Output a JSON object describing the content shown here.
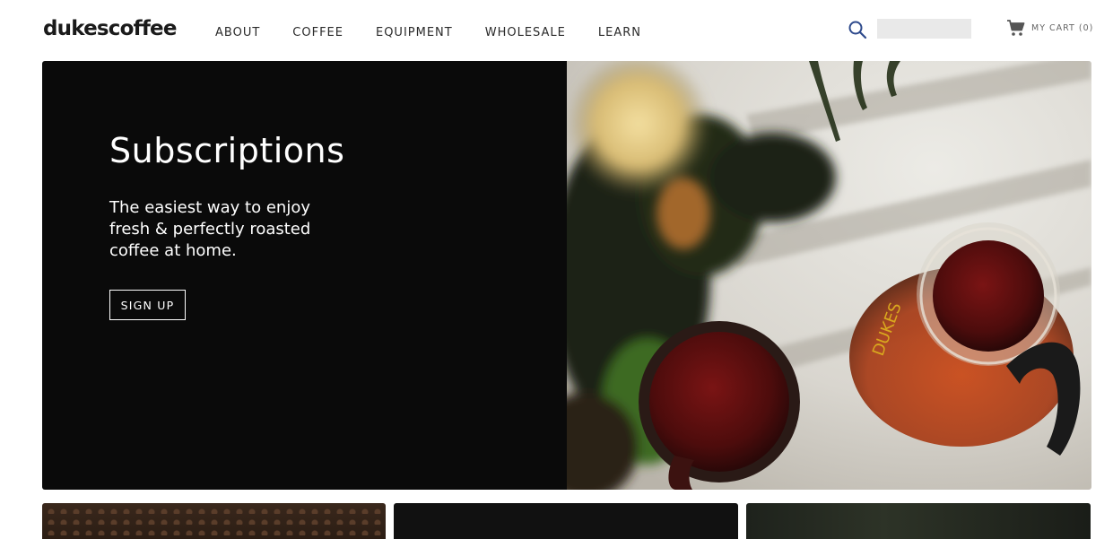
{
  "header": {
    "logo": "dukescoffee",
    "nav": [
      {
        "label": "ABOUT"
      },
      {
        "label": "COFFEE"
      },
      {
        "label": "EQUIPMENT"
      },
      {
        "label": "WHOLESALE"
      },
      {
        "label": "LEARN"
      }
    ],
    "search": {
      "placeholder": "",
      "value": ""
    },
    "cart_label": "MY CART (0)"
  },
  "hero": {
    "title": "Subscriptions",
    "description": "The easiest way to enjoy fresh & perfectly roasted coffee at home.",
    "button_label": "SIGN UP"
  },
  "colors": {
    "hero_bg": "#0a0a0a",
    "accent": "#2e4a8c"
  },
  "icons": {
    "search": "search-icon",
    "cart": "cart-icon"
  }
}
